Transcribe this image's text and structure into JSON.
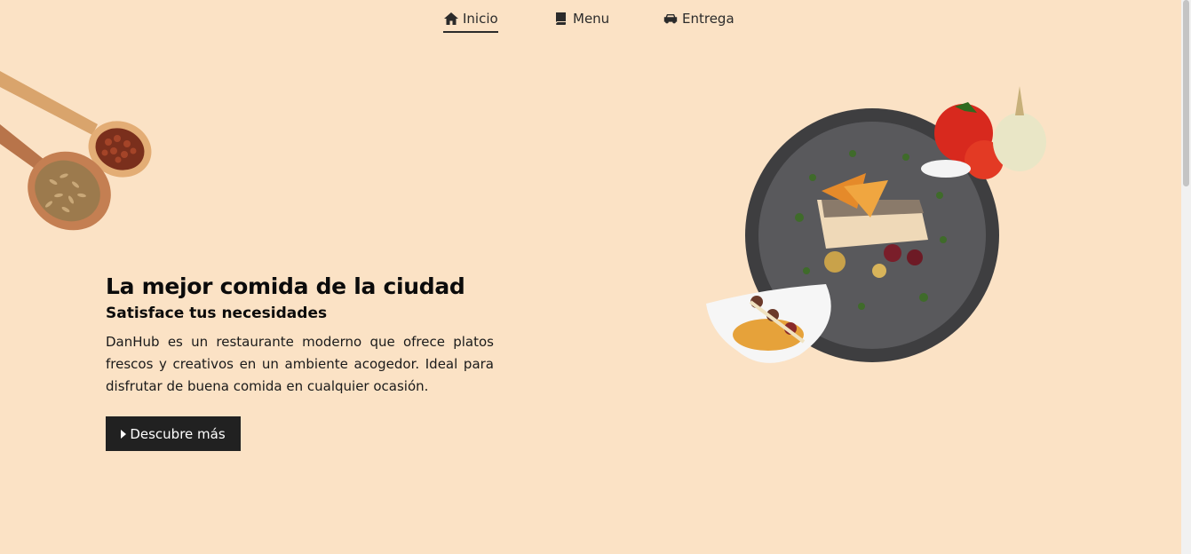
{
  "nav": {
    "items": [
      {
        "label": "Inicio",
        "icon": "home-icon",
        "active": true
      },
      {
        "label": "Menu",
        "icon": "book-icon",
        "active": false
      },
      {
        "label": "Entrega",
        "icon": "car-icon",
        "active": false
      }
    ]
  },
  "hero": {
    "title": "La mejor comida de la ciudad",
    "subtitle": "Satisface tus necesidades",
    "description": "DanHub es un restaurante moderno que ofrece platos frescos y creativos en un ambiente acogedor. Ideal para disfrutar de buena comida en cualquier ocasión.",
    "cta_label": "Descubre más",
    "cta_icon": "caret-right-icon"
  },
  "images": {
    "spoons": "spices-spoons-image",
    "dish": "gourmet-fish-plate-image"
  },
  "colors": {
    "background": "#fbe2c5",
    "text": "#111111",
    "button": "#212121",
    "button_text": "#ffffff"
  }
}
